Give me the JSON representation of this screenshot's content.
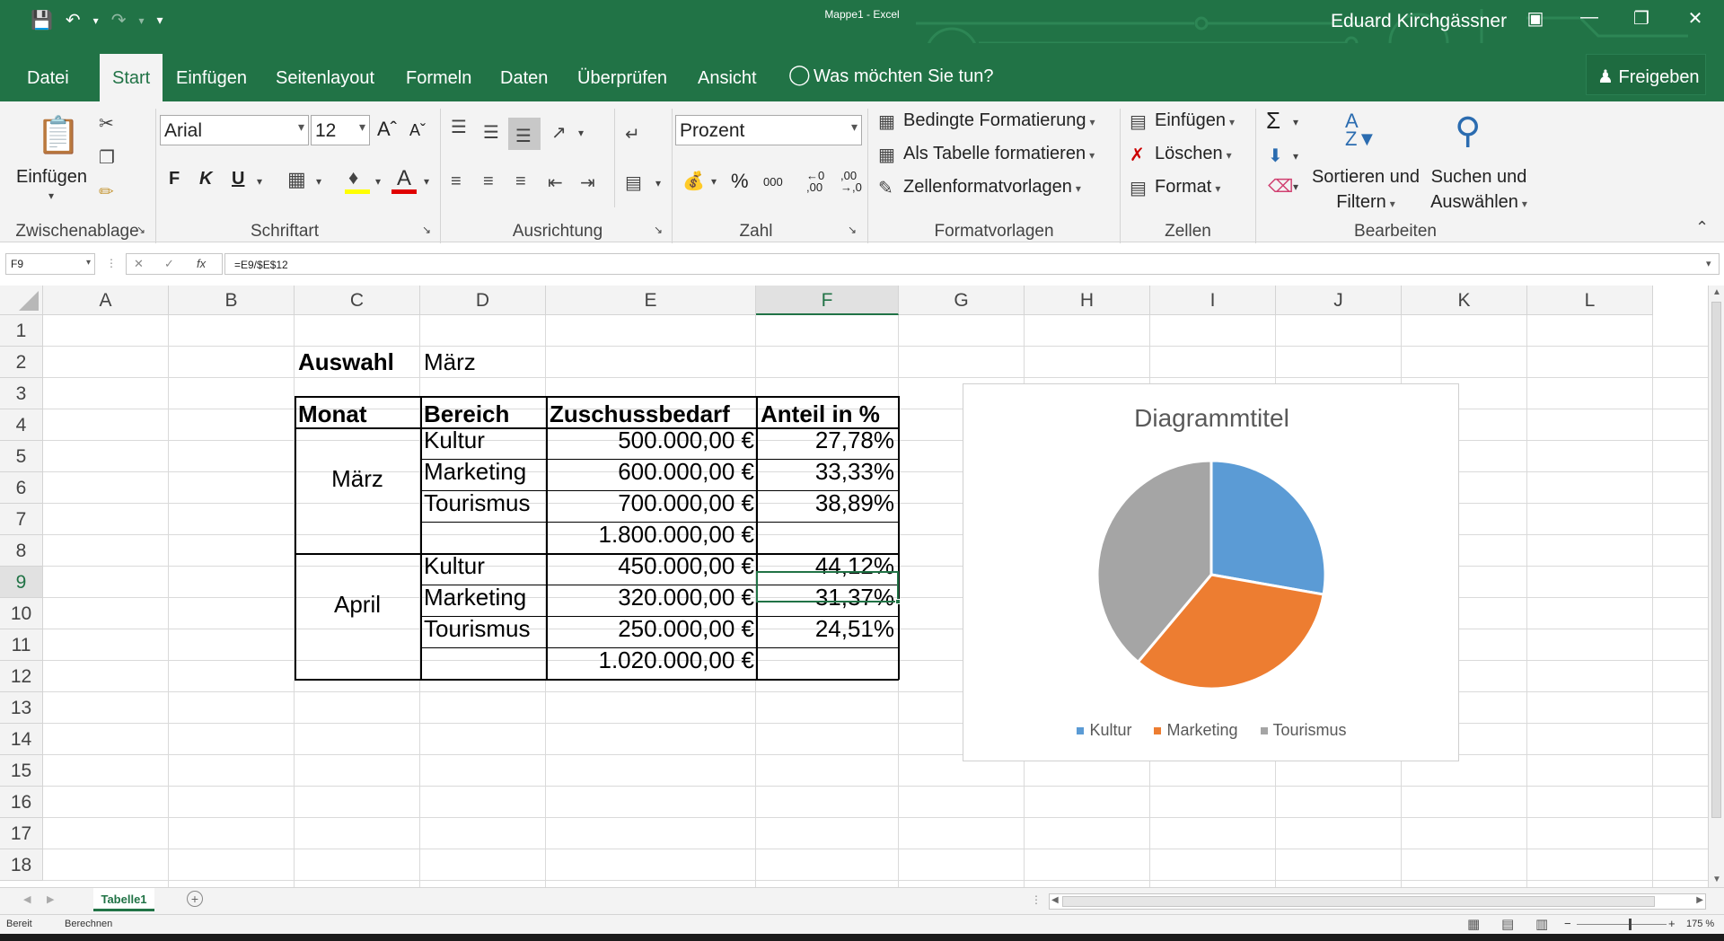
{
  "window": {
    "doc_title": "Mappe1 - Excel",
    "user": "Eduard Kirchgässner"
  },
  "tabs": [
    "Datei",
    "Start",
    "Einfügen",
    "Seitenlayout",
    "Formeln",
    "Daten",
    "Überprüfen",
    "Ansicht"
  ],
  "tellme": "Was möchten Sie tun?",
  "share": "Freigeben",
  "ribbon": {
    "clipboard": {
      "paste": "Einfügen",
      "label": "Zwischenablage"
    },
    "font": {
      "name": "Arial",
      "size": "12",
      "bold": "F",
      "italic": "K",
      "underline": "U",
      "label": "Schriftart"
    },
    "alignment": {
      "label": "Ausrichtung"
    },
    "number": {
      "format": "Prozent",
      "percent": "%",
      "thousands": "000",
      "label": "Zahl"
    },
    "styles": {
      "conditional": "Bedingte Formatierung",
      "as_table": "Als Tabelle formatieren",
      "cell_styles": "Zellenformatvorlagen",
      "label": "Formatvorlagen"
    },
    "cells": {
      "insert": "Einfügen",
      "delete": "Löschen",
      "format": "Format",
      "label": "Zellen"
    },
    "editing": {
      "sort_1": "Sortieren und",
      "sort_2": "Filtern",
      "find_1": "Suchen und",
      "find_2": "Auswählen",
      "label": "Bearbeiten"
    }
  },
  "formula_bar": {
    "name_box": "F9",
    "formula": "=E9/$E$12"
  },
  "columns": [
    "A",
    "B",
    "C",
    "D",
    "E",
    "F",
    "G",
    "H",
    "I",
    "J",
    "K",
    "L"
  ],
  "rows": [
    "1",
    "2",
    "3",
    "4",
    "5",
    "6",
    "7",
    "8",
    "9",
    "10",
    "11",
    "12",
    "13",
    "14",
    "15",
    "16",
    "17",
    "18"
  ],
  "sheet": {
    "auswahl_label": "Auswahl",
    "auswahl_value": "März",
    "headers": [
      "Monat",
      "Bereich",
      "Zuschussbedarf",
      "Anteil in %"
    ],
    "groups": [
      {
        "month": "März",
        "rows": [
          {
            "bereich": "Kultur",
            "betrag": "500.000,00 €",
            "anteil": "27,78%"
          },
          {
            "bereich": "Marketing",
            "betrag": "600.000,00 €",
            "anteil": "33,33%"
          },
          {
            "bereich": "Tourismus",
            "betrag": "700.000,00 €",
            "anteil": "38,89%"
          }
        ],
        "total": "1.800.000,00 €"
      },
      {
        "month": "April",
        "rows": [
          {
            "bereich": "Kultur",
            "betrag": "450.000,00 €",
            "anteil": "44,12%"
          },
          {
            "bereich": "Marketing",
            "betrag": "320.000,00 €",
            "anteil": "31,37%"
          },
          {
            "bereich": "Tourismus",
            "betrag": "250.000,00 €",
            "anteil": "24,51%"
          }
        ],
        "total": "1.020.000,00 €"
      }
    ]
  },
  "chart_data": {
    "type": "pie",
    "title": "Diagrammtitel",
    "categories": [
      "Kultur",
      "Marketing",
      "Tourismus"
    ],
    "values": [
      27.78,
      33.33,
      38.89
    ],
    "colors": [
      "#5b9bd5",
      "#ed7d31",
      "#a5a5a5"
    ],
    "legend": "bottom"
  },
  "sheet_tab": "Tabelle1",
  "status": {
    "ready": "Bereit",
    "calc": "Berechnen",
    "zoom": "175 %"
  },
  "colors": {
    "excel_green": "#217346"
  }
}
